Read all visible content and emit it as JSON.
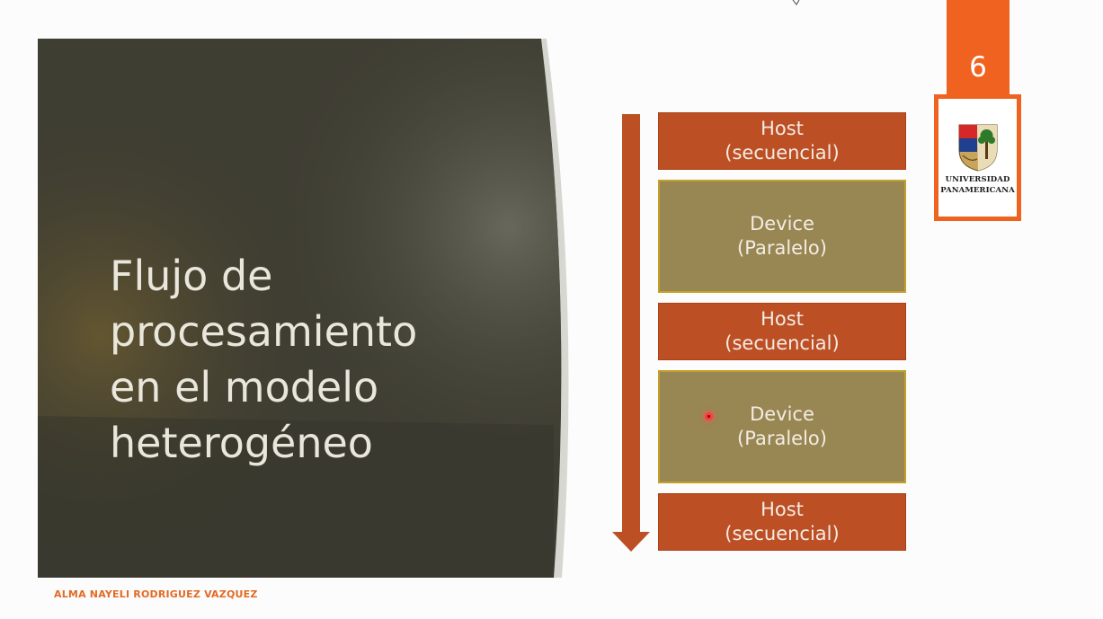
{
  "slide": {
    "title_lines": [
      "Flujo de",
      "procesamiento",
      "en el modelo",
      "heterogéneo"
    ],
    "page_number": "6",
    "author": "ALMA NAYELI RODRIGUEZ VAZQUEZ"
  },
  "logo": {
    "line1": "UNIVERSIDAD",
    "line2": "PANAMERICANA"
  },
  "flow_blocks": [
    {
      "kind": "host",
      "line1": "Host",
      "line2": "(secuencial)"
    },
    {
      "kind": "device",
      "line1": "Device",
      "line2": "(Paralelo)"
    },
    {
      "kind": "host",
      "line1": "Host",
      "line2": "(secuencial)"
    },
    {
      "kind": "device",
      "line1": "Device",
      "line2": "(Paralelo)"
    },
    {
      "kind": "host",
      "line1": "Host",
      "line2": "(secuencial)"
    }
  ],
  "colors": {
    "accent": "#f0621f",
    "host": "#bd4f25",
    "device": "#988753",
    "device_border": "#c2a02a",
    "panel": "#3f3e33"
  },
  "icons": [
    "flow-arrow-down-icon",
    "university-crest-icon",
    "laser-pointer-icon"
  ]
}
